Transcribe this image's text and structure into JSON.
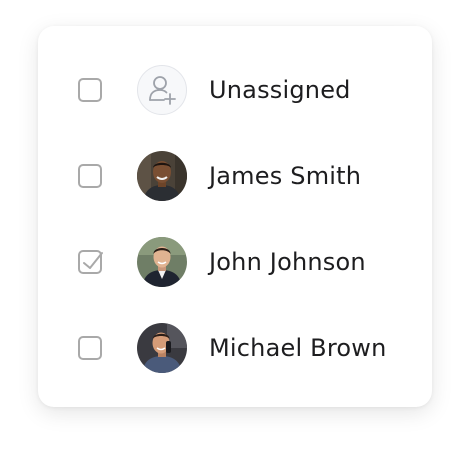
{
  "assignees": [
    {
      "name": "Unassigned",
      "checked": false,
      "avatar": "add-user-icon"
    },
    {
      "name": "James Smith",
      "checked": false,
      "avatar": "photo",
      "colors": {
        "bg": "#4a4238",
        "skin": "#7a4f33",
        "shirt": "#2b2e33"
      }
    },
    {
      "name": "John Johnson",
      "checked": true,
      "avatar": "photo",
      "colors": {
        "bg": "#6f7e66",
        "skin": "#e0b391",
        "shirt": "#1f2430"
      }
    },
    {
      "name": "Michael Brown",
      "checked": false,
      "avatar": "photo",
      "colors": {
        "bg": "#3a3a40",
        "skin": "#d59c78",
        "shirt": "#4a5a7a"
      }
    }
  ]
}
